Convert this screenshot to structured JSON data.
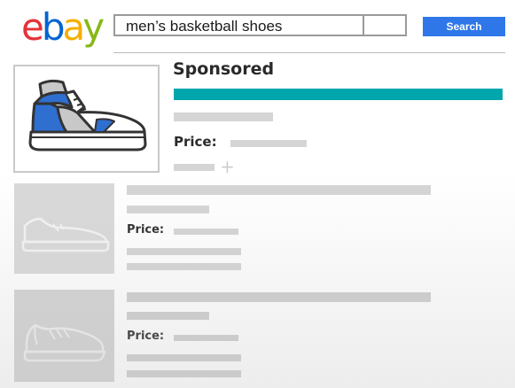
{
  "header": {
    "logo_letters": [
      {
        "ch": "e",
        "color": "#e53238"
      },
      {
        "ch": "b",
        "color": "#0064d2"
      },
      {
        "ch": "a",
        "color": "#f5af02"
      },
      {
        "ch": "y",
        "color": "#86b817"
      }
    ],
    "search": {
      "query": "men’s basketball shoes",
      "button_label": "Search"
    }
  },
  "colors": {
    "search_button": "#2f77e8",
    "sponsored_bar": "#00a6ac",
    "placeholder": "#d5d5d5"
  },
  "results": {
    "sponsored": {
      "title": "Sponsored",
      "price_label": "Price:",
      "icon": "high-top-sneaker-icon"
    },
    "items": [
      {
        "price_label": "Price:",
        "icon": "low-top-sneaker-icon"
      },
      {
        "price_label": "Price:",
        "icon": "running-shoe-icon"
      }
    ]
  }
}
